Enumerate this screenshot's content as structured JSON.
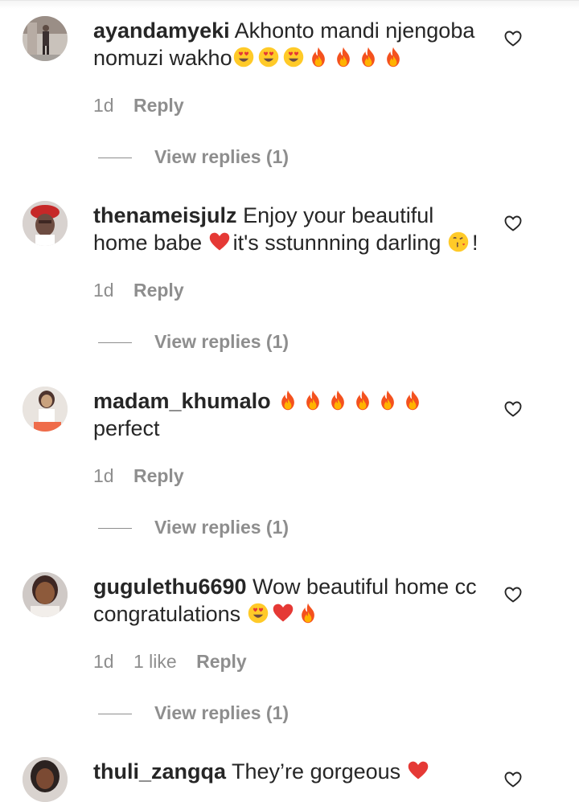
{
  "comments": [
    {
      "username": "ayandamyeki",
      "text": "Akhonto mandi njengoba nomuzi wakho",
      "emojis": [
        "heart-eyes",
        "heart-eyes",
        "heart-eyes",
        "fire",
        "fire",
        "fire",
        "fire"
      ],
      "time": "1d",
      "likes": "",
      "reply": "Reply",
      "view_replies": "View replies (1)"
    },
    {
      "username": "thenameisjulz",
      "text": "Enjoy your beautiful home babe",
      "text_after_heart": "it's sstunnning darling",
      "text_end": "!",
      "time": "1d",
      "likes": "",
      "reply": "Reply",
      "view_replies": "View replies (1)"
    },
    {
      "username": "madam_khumalo",
      "text": "perfect",
      "emojis": [
        "fire",
        "fire",
        "fire",
        "fire",
        "fire",
        "fire"
      ],
      "time": "1d",
      "likes": "",
      "reply": "Reply",
      "view_replies": "View replies (1)"
    },
    {
      "username": "gugulethu6690",
      "text": "Wow beautiful home cc congratulations",
      "emojis": [
        "heart-eyes",
        "red-heart",
        "fire"
      ],
      "time": "1d",
      "likes": "1 like",
      "reply": "Reply",
      "view_replies": "View replies (1)"
    },
    {
      "username": "thuli_zangqa",
      "text": "They’re gorgeous",
      "emojis": [
        "red-heart"
      ],
      "time": "",
      "likes": "",
      "reply": "",
      "view_replies": ""
    }
  ],
  "icons": {
    "like": "heart-outline-icon",
    "fire": "fire-emoji",
    "heart_eyes": "heart-eyes-emoji",
    "red_heart": "red-heart-emoji",
    "kiss": "face-blowing-kiss-emoji"
  },
  "colors": {
    "text": "#262626",
    "secondary": "#8e8e8e",
    "background": "#ffffff"
  }
}
